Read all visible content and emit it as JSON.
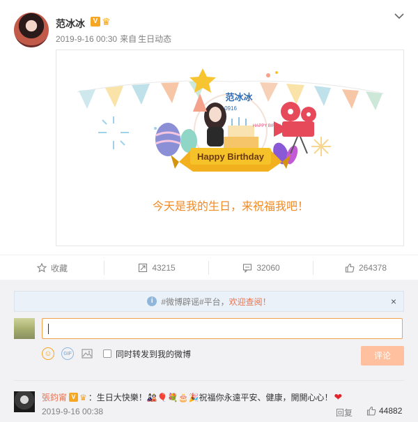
{
  "post": {
    "author": "范冰冰",
    "verified_badge": "V",
    "time": "2019-9-16 00:30",
    "source_prefix": "来自",
    "source": "生日动态"
  },
  "card": {
    "banner_name": "范冰冰",
    "banner_date": "0916",
    "banner_side_text": "HAPPY BIRTH DAY!!",
    "ribbon_text": "Happy Birthday",
    "text": "今天是我的生日，来祝福我吧！"
  },
  "actions": {
    "favorite": "收藏",
    "repost_count": "43215",
    "comment_count": "32060",
    "like_count": "264378"
  },
  "comment_box": {
    "notice_prefix": "#微博辟谣#平台，",
    "notice_highlight": "欢迎查阅！",
    "close": "×",
    "repost_label": "同时转发到我的微博",
    "submit_label": "评论"
  },
  "comments": [
    {
      "user": "張鈞甯",
      "badge": "V",
      "text": "：生日大快樂！🎎🎈💐🎂🎉祝福你永遠平安、健康，開開心心！",
      "time": "2019-9-16 00:38",
      "reply_label": "回复",
      "likes": "44882"
    }
  ],
  "colors": {
    "accent_orange": "#eb7350",
    "card_text": "#f08a24",
    "badge_gold": "#f5a623"
  },
  "icons": [
    "chevron-down-icon",
    "star-icon",
    "repost-icon",
    "comment-icon",
    "thumbs-up-icon",
    "info-icon",
    "close-icon",
    "emoji-icon",
    "gif-icon",
    "image-icon",
    "heart-icon"
  ]
}
